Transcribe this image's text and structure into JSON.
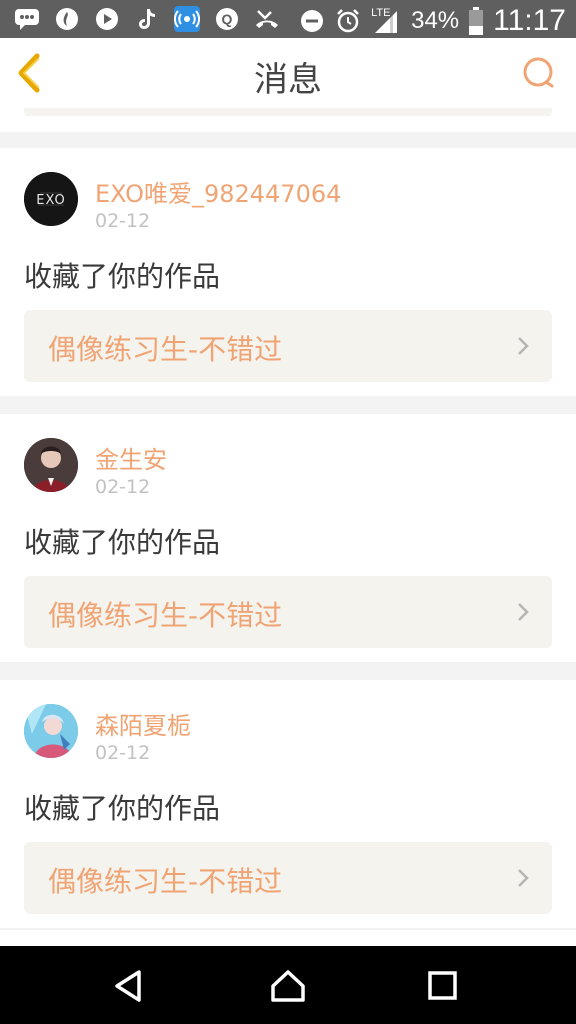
{
  "status_bar": {
    "left_icons": [
      "message-icon",
      "fire-app-icon",
      "video-app-icon",
      "tiktok-icon",
      "wifi-hotspot-icon",
      "baidu-icon",
      "missed-call-icon"
    ],
    "battery_text": "34%",
    "network_label": "LTE",
    "time": "11:17"
  },
  "header": {
    "title": "消息",
    "back_icon": "chevron-left-icon",
    "search_icon": "search-icon"
  },
  "accent_color": "#f0a474",
  "notifications": [
    {
      "username": "EXO唯爱_982447064",
      "date": "02-12",
      "action": "收藏了你的作品",
      "work_title": "偶像练习生-不错过",
      "avatar": "exo-logo-avatar"
    },
    {
      "username": "金生安",
      "date": "02-12",
      "action": "收藏了你的作品",
      "work_title": "偶像练习生-不错过",
      "avatar": "portrait-avatar"
    },
    {
      "username": "森陌夏栀",
      "date": "02-12",
      "action": "收藏了你的作品",
      "work_title": "偶像练习生-不错过",
      "avatar": "anime-avatar"
    }
  ],
  "nav_bar": [
    "back-triangle-icon",
    "home-icon",
    "recents-icon"
  ]
}
